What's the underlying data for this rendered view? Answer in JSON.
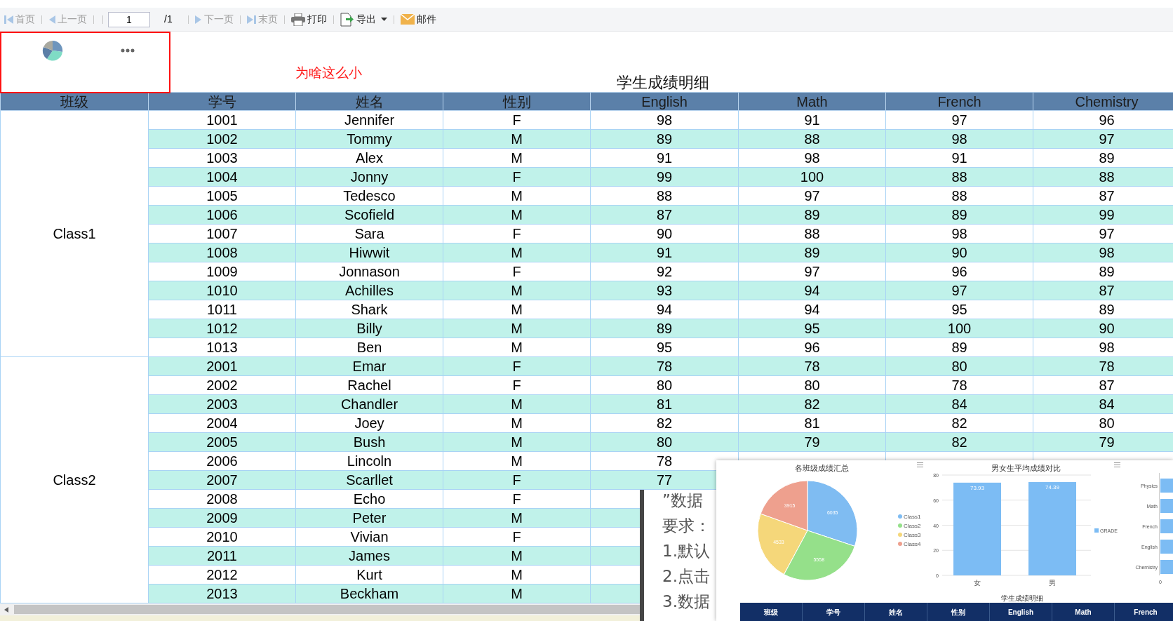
{
  "toolbar": {
    "items": [
      {
        "kind": "first",
        "label": "首页",
        "disabled": true
      },
      {
        "kind": "prev",
        "label": "上一页",
        "disabled": true
      },
      {
        "kind": "page_input",
        "value": "1"
      },
      {
        "kind": "page_total",
        "label": "/1"
      },
      {
        "kind": "next",
        "label": "下一页",
        "disabled": true
      },
      {
        "kind": "last",
        "label": "末页",
        "disabled": true
      },
      {
        "kind": "print",
        "label": "打印",
        "disabled": false
      },
      {
        "kind": "export",
        "label": "导出",
        "disabled": false
      },
      {
        "kind": "mail",
        "label": "邮件",
        "disabled": false
      }
    ]
  },
  "annotation": {
    "text": "为啥这么小"
  },
  "report": {
    "title": "学生成绩明细",
    "columns": [
      "班级",
      "学号",
      "姓名",
      "性别",
      "English",
      "Math",
      "French",
      "Chemistry"
    ],
    "groups": [
      {
        "class": "Class1",
        "rows": [
          {
            "cells": [
              "1001",
              "Jennifer",
              "F",
              "98",
              "91",
              "97",
              "96"
            ]
          },
          {
            "cells": [
              "1002",
              "Tommy",
              "M",
              "89",
              "88",
              "98",
              "97"
            ]
          },
          {
            "cells": [
              "1003",
              "Alex",
              "M",
              "91",
              "98",
              "91",
              "89"
            ]
          },
          {
            "cells": [
              "1004",
              "Jonny",
              "F",
              "99",
              "100",
              "88",
              "88"
            ]
          },
          {
            "cells": [
              "1005",
              "Tedesco",
              "M",
              "88",
              "97",
              "88",
              "87"
            ]
          },
          {
            "cells": [
              "1006",
              "Scofield",
              "M",
              "87",
              "89",
              "89",
              "99"
            ]
          },
          {
            "cells": [
              "1007",
              "Sara",
              "F",
              "90",
              "88",
              "98",
              "97"
            ]
          },
          {
            "cells": [
              "1008",
              "Hiwwit",
              "M",
              "91",
              "89",
              "90",
              "98"
            ]
          },
          {
            "cells": [
              "1009",
              "Jonnason",
              "F",
              "92",
              "97",
              "96",
              "89"
            ]
          },
          {
            "cells": [
              "1010",
              "Achilles",
              "M",
              "93",
              "94",
              "97",
              "87"
            ]
          },
          {
            "cells": [
              "1011",
              "Shark",
              "M",
              "94",
              "94",
              "95",
              "89"
            ]
          },
          {
            "cells": [
              "1012",
              "Billy",
              "M",
              "89",
              "95",
              "100",
              "90"
            ]
          },
          {
            "cells": [
              "1013",
              "Ben",
              "M",
              "95",
              "96",
              "89",
              "98"
            ]
          }
        ]
      },
      {
        "class": "Class2",
        "rows": [
          {
            "cells": [
              "2001",
              "Emar",
              "F",
              "78",
              "78",
              "80",
              "78"
            ]
          },
          {
            "cells": [
              "2002",
              "Rachel",
              "F",
              "80",
              "80",
              "78",
              "87"
            ]
          },
          {
            "cells": [
              "2003",
              "Chandler",
              "M",
              "81",
              "82",
              "84",
              "84"
            ]
          },
          {
            "cells": [
              "2004",
              "Joey",
              "M",
              "82",
              "81",
              "82",
              "80"
            ]
          },
          {
            "cells": [
              "2005",
              "Bush",
              "M",
              "80",
              "79",
              "82",
              "79"
            ]
          },
          {
            "cells": [
              "2006",
              "Lincoln",
              "M",
              "78"
            ]
          },
          {
            "cells": [
              "2007",
              "Scarllet",
              "F",
              "77"
            ]
          },
          {
            "cells": [
              "2008",
              "Echo",
              "F"
            ]
          },
          {
            "cells": [
              "2009",
              "Peter",
              "M"
            ]
          },
          {
            "cells": [
              "2010",
              "Vivian",
              "F"
            ]
          },
          {
            "cells": [
              "2011",
              "James",
              "M"
            ]
          },
          {
            "cells": [
              "2012",
              "Kurt",
              "M"
            ]
          },
          {
            "cells": [
              "2013",
              "Beckham",
              "M"
            ]
          }
        ]
      }
    ]
  },
  "doc_popup": {
    "lines": [
      "”数据",
      "要求：",
      "1.默认",
      "2.点击",
      "3.数据"
    ]
  },
  "dashboard_preview": {
    "pie": {
      "chart_data": {
        "type": "pie",
        "title": "各班级成绩汇总",
        "categories": [
          "Class1",
          "Class2",
          "Class3",
          "Class4"
        ],
        "values": [
          6035,
          5558,
          4533,
          3915
        ],
        "data_labels": true,
        "legend": "right"
      }
    },
    "bar": {
      "chart_data": {
        "type": "bar",
        "title": "男女生平均成绩对比",
        "categories": [
          "女",
          "男"
        ],
        "series": [
          {
            "name": "GRADE",
            "color": "#7cbcf4",
            "values": [
              73.93,
              74.39
            ]
          }
        ],
        "ylim": [
          0,
          80
        ],
        "yticks": [
          0,
          20,
          40,
          60,
          80
        ],
        "data_labels": true,
        "legend": "right",
        "grid": true
      }
    },
    "hbar": {
      "labels": [
        "Physics",
        "Math",
        "French",
        "English",
        "Chemistry"
      ],
      "axis_label": "0"
    },
    "table_title": "学生成绩明细",
    "table_columns": [
      "班级",
      "学号",
      "姓名",
      "性别",
      "English",
      "Math",
      "French"
    ]
  }
}
